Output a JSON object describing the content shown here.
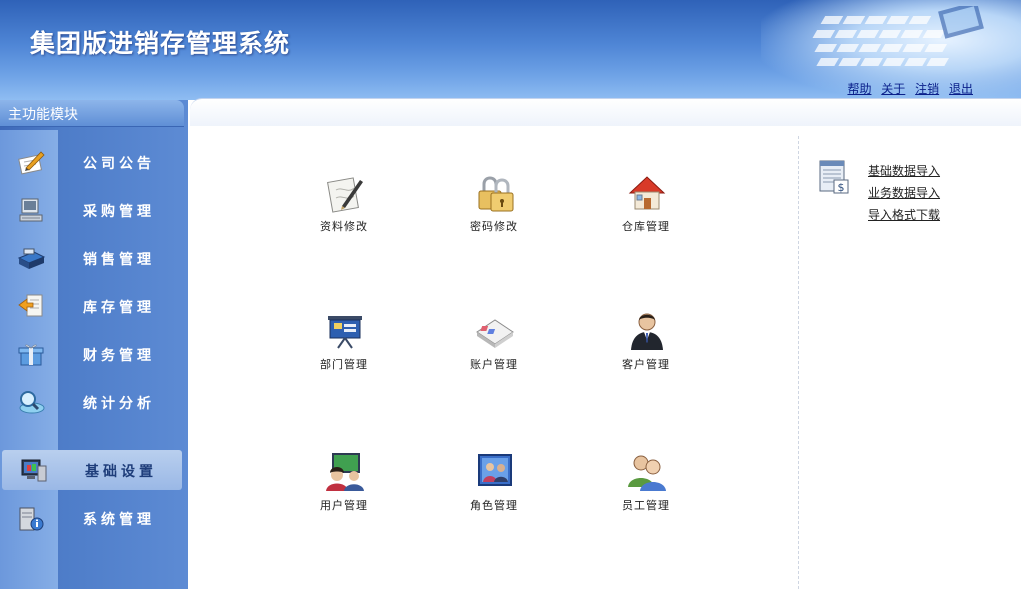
{
  "header": {
    "title": "集团版进销存管理系统",
    "links": [
      {
        "label": "帮助"
      },
      {
        "label": "关于"
      },
      {
        "label": "注销"
      },
      {
        "label": "退出"
      }
    ]
  },
  "sidebar": {
    "heading": "主功能模块",
    "items": [
      {
        "label": "公司公告",
        "icon": "pen-paper-icon"
      },
      {
        "label": "采购管理",
        "icon": "computer-terminal-icon"
      },
      {
        "label": "销售管理",
        "icon": "cash-register-icon"
      },
      {
        "label": "库存管理",
        "icon": "document-arrow-icon"
      },
      {
        "label": "财务管理",
        "icon": "gift-box-icon"
      },
      {
        "label": "统计分析",
        "icon": "magnifier-globe-icon"
      },
      {
        "label": "基础设置",
        "icon": "monitor-settings-icon",
        "active": true
      },
      {
        "label": "系统管理",
        "icon": "server-info-icon"
      }
    ]
  },
  "main": {
    "tiles": [
      {
        "label": "资料修改",
        "icon": "document-pen-icon"
      },
      {
        "label": "密码修改",
        "icon": "padlock-icon"
      },
      {
        "label": "仓库管理",
        "icon": "house-icon"
      },
      {
        "label": "部门管理",
        "icon": "presentation-board-icon"
      },
      {
        "label": "账户管理",
        "icon": "account-book-icon"
      },
      {
        "label": "客户管理",
        "icon": "businessman-icon"
      },
      {
        "label": "用户管理",
        "icon": "users-monitor-icon"
      },
      {
        "label": "角色管理",
        "icon": "role-portrait-icon"
      },
      {
        "label": "员工管理",
        "icon": "staff-people-icon"
      }
    ],
    "imports": [
      {
        "label": "基础数据导入"
      },
      {
        "label": "业务数据导入"
      },
      {
        "label": "导入格式下载"
      }
    ]
  },
  "colors": {
    "header_blue": "#4f86d6",
    "sidebar_blue": "#4d7cc8",
    "link_blue": "#0a1f8a"
  }
}
